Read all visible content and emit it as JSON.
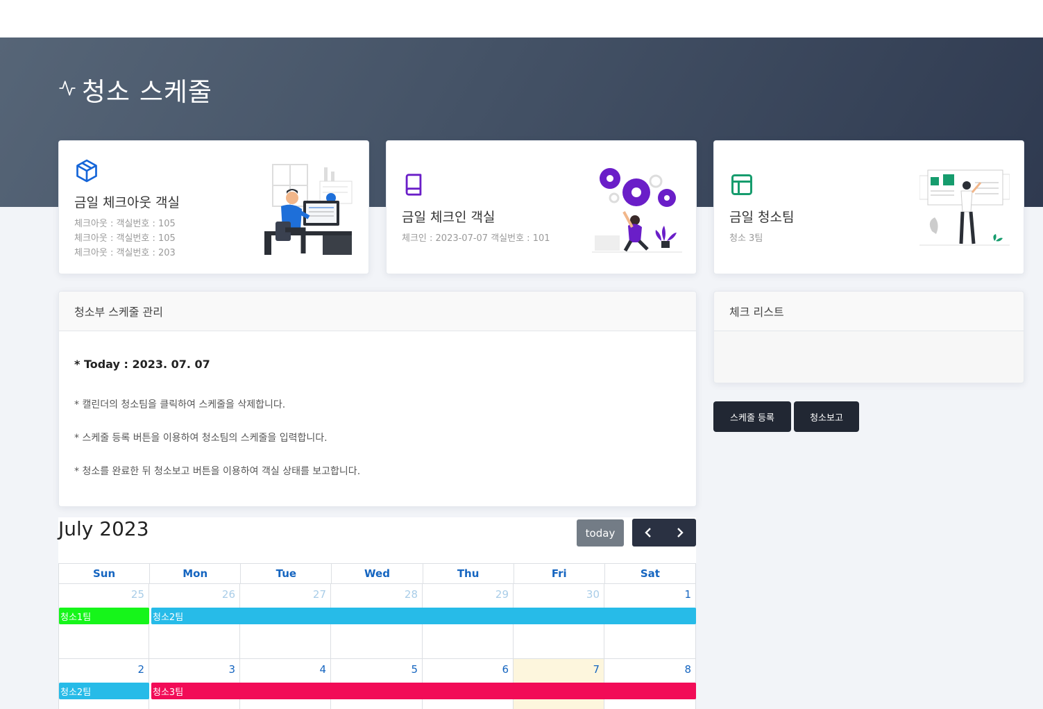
{
  "page": {
    "title": "청소 스케줄",
    "title_icon": "activity-icon"
  },
  "cards": [
    {
      "icon": "box-icon",
      "icon_color": "#1565d8",
      "title": "금일 체크아웃 객실",
      "lines": [
        "체크아웃 : 객실번호 : 105",
        "체크아웃 : 객실번호 : 105",
        "체크아웃 : 객실번호 : 203"
      ]
    },
    {
      "icon": "book-icon",
      "icon_color": "#6a1ec8",
      "title": "금일 체크인 객실",
      "lines": [
        "체크인 : 2023-07-07 객실번호 : 101"
      ]
    },
    {
      "icon": "layout-icon",
      "icon_color": "#169c6d",
      "title": "금일 청소팀",
      "lines": [
        "청소 3팀"
      ]
    }
  ],
  "schedule_panel": {
    "header": "청소부 스케줄 관리",
    "today": "* Today : 2023. 07. 07",
    "notes": [
      "* 캘린더의 청소팀을 클릭하여 스케줄을 삭제합니다.",
      "* 스케줄 등록 버튼을 이용하여 청소팀의 스케줄을 입력합니다.",
      "* 청소를 완료한 뒤 청소보고 버튼을 이용하여 객실 상태를 보고합니다."
    ]
  },
  "checklist_panel": {
    "header": "체크 리스트"
  },
  "buttons": {
    "register": "스케줄 등록",
    "report": "청소보고"
  },
  "calendar": {
    "title": "July 2023",
    "today_label": "today",
    "weekdays": [
      "Sun",
      "Mon",
      "Tue",
      "Wed",
      "Thu",
      "Fri",
      "Sat"
    ],
    "weeks": [
      {
        "days": [
          "25",
          "26",
          "27",
          "28",
          "29",
          "30",
          "1"
        ],
        "other_month": [
          true,
          true,
          true,
          true,
          true,
          true,
          false
        ]
      },
      {
        "days": [
          "2",
          "3",
          "4",
          "5",
          "6",
          "7",
          "8"
        ],
        "other_month": [
          false,
          false,
          false,
          false,
          false,
          false,
          false
        ],
        "today_index": 5
      }
    ],
    "events": [
      {
        "week": 0,
        "start": 0,
        "span": 1,
        "label": "청소1팀",
        "color": "#16f51a"
      },
      {
        "week": 0,
        "start": 1,
        "span": 6,
        "label": "청소2팀",
        "color": "#27bbe8"
      },
      {
        "week": 1,
        "start": 0,
        "span": 1,
        "label": "청소2팀",
        "color": "#27bbe8"
      },
      {
        "week": 1,
        "start": 1,
        "span": 6,
        "label": "청소3팀",
        "color": "#f20c57"
      }
    ]
  }
}
